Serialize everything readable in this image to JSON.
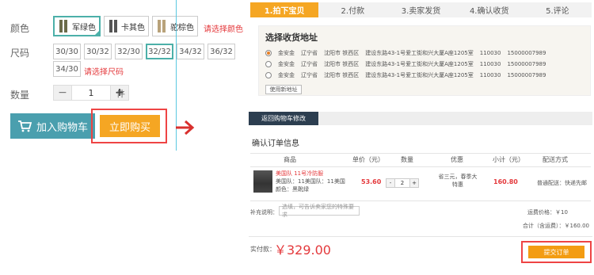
{
  "colors": {
    "accent_teal": "#4cb0a9",
    "cart_blue": "#4a9fae",
    "buy_orange": "#f5a623",
    "alert_red": "#e4393c",
    "highlight_border": "#ee4444",
    "nav_dark": "#2c3e50"
  },
  "product": {
    "color_label": "颜色",
    "color_options": [
      {
        "label": "军绿色",
        "selected": true,
        "swatch": "#6b6b4a"
      },
      {
        "label": "卡其色",
        "selected": false,
        "swatch": "#555555"
      },
      {
        "label": "驼棕色",
        "selected": false,
        "swatch": "#b8a27a"
      }
    ],
    "color_warning": "请选择颜色",
    "size_label": "尺码",
    "size_options": [
      {
        "label": "30/30",
        "selected": false
      },
      {
        "label": "30/32",
        "selected": false
      },
      {
        "label": "32/30",
        "selected": false
      },
      {
        "label": "32/32",
        "selected": true
      },
      {
        "label": "34/32",
        "selected": false
      },
      {
        "label": "36/32",
        "selected": false
      },
      {
        "label": "34/30",
        "selected": false
      }
    ],
    "size_warning": "请选择尺码",
    "qty_label": "数量",
    "qty_minus": "−",
    "qty_value": "1",
    "qty_plus": "+",
    "qty_unit": "件",
    "cart_icon": "cart-icon",
    "add_to_cart": "加入购物车",
    "buy_now": "立即购买"
  },
  "checkout": {
    "steps": [
      {
        "label": "1.拍下宝贝",
        "active": true
      },
      {
        "label": "2.付款",
        "active": false
      },
      {
        "label": "3.卖家发货",
        "active": false
      },
      {
        "label": "4.确认收货",
        "active": false
      },
      {
        "label": "5.评论",
        "active": false
      }
    ],
    "address_title": "选择收货地址",
    "addresses": [
      {
        "name": "金安金",
        "province": "辽宁省",
        "city": "沈阳市 铁西区",
        "street": "建设东路43-1号爱工街和兴大厦A座1205室",
        "zip": "110030",
        "phone": "15000007989",
        "checked": true
      },
      {
        "name": "金安金",
        "province": "辽宁省",
        "city": "沈阳市 铁西区",
        "street": "建设东路43-1号爱工街和兴大厦A座1205室",
        "zip": "110030",
        "phone": "15000007989",
        "checked": false
      },
      {
        "name": "金安金",
        "province": "辽宁省",
        "city": "沈阳市 铁西区",
        "street": "建设东路43-1号爱工街和兴大厦A座1205室",
        "zip": "110030",
        "phone": "15000007989",
        "checked": false
      }
    ],
    "new_address": "使用新地址",
    "back_to_cart": "返回购物车修改",
    "confirm_title": "确认订单信息",
    "table_headers": [
      "商品",
      "单价（元）",
      "数量",
      "优惠",
      "小计（元）",
      "配送方式"
    ],
    "item": {
      "name_line": "美国队 11号冷防服",
      "detail_line1": "美国队：11美国队：11美国",
      "detail_line2": "颜色：黑靴绿",
      "unit_price": "53.60",
      "qty_minus": "-",
      "qty": "2",
      "qty_plus": "+",
      "discount_line1": "省三元，春季大",
      "discount_line2": "特惠",
      "subtotal": "160.80",
      "shipping": "普通配送：快递先邮"
    },
    "remark_label": "补充说明：",
    "remark_placeholder": "选填，可告诉卖家您的特殊要求",
    "shipping_fee_label": "运费价格：",
    "shipping_fee": "￥10",
    "total_label": "合计（含运费）：",
    "total": "￥160.00",
    "pay_label": "实付款：",
    "pay_amount": "￥329.00",
    "submit": "提交订单"
  }
}
